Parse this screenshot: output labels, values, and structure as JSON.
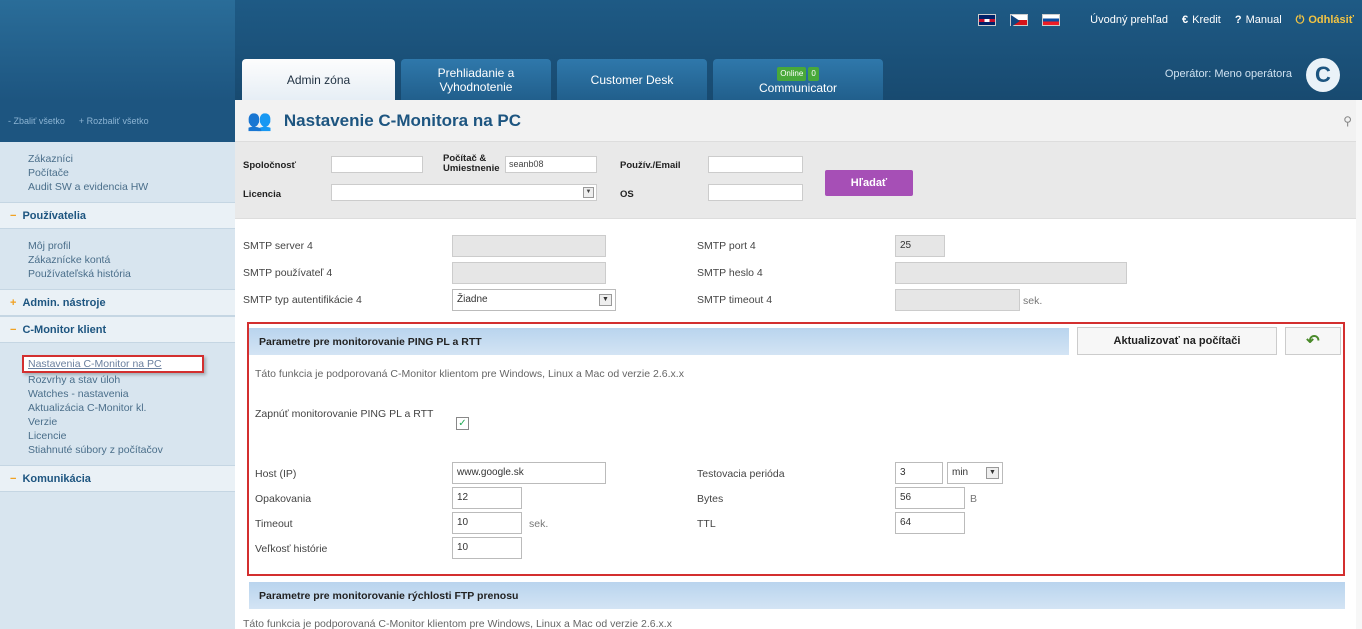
{
  "header": {
    "links": {
      "overview": "Úvodný prehľad",
      "credit": "Kredit",
      "manual": "Manual",
      "logout": "Odhlásiť"
    },
    "tabs": [
      {
        "label": "Admin zóna"
      },
      {
        "label": "Prehliadanie a Vyhodnotenie"
      },
      {
        "label": "Customer Desk"
      },
      {
        "label": "Communicator",
        "badge": "Online",
        "count": "0"
      }
    ],
    "operator": "Operátor: Meno operátora",
    "logo_letter": "C"
  },
  "sidebar": {
    "collapse_all": "Zbaliť všetko",
    "expand_all": "Rozbaliť všetko",
    "group1": [
      "Zákazníci",
      "Počítače",
      "Audit SW a evidencia HW"
    ],
    "users_header": "Používatelia",
    "users_items": [
      "Môj profil",
      "Zákaznícke kontá",
      "Používateľská história"
    ],
    "admin_header": "Admin. nástroje",
    "cmon_header": "C-Monitor klient",
    "cmon_items": [
      "Nastavenia C-Monitor na PC",
      "Rozvrhy a stav úloh",
      "Watches - nastavenia",
      "Aktualizácia C-Monitor kl.",
      "Verzie",
      "Licencie",
      "Stiahnuté súbory z počítačov"
    ],
    "comm_header": "Komunikácia"
  },
  "main": {
    "title": "Nastavenie C-Monitora na PC",
    "filter": {
      "company_label": "Spoločnosť",
      "computer_label": "Počítač & Umiestnenie",
      "computer_value": "seanb08",
      "user_label": "Použív./Email",
      "license_label": "Licencia",
      "os_label": "OS",
      "search_button": "Hľadať"
    },
    "smtp": {
      "server_label": "SMTP server 4",
      "port_label": "SMTP port 4",
      "port_value": "25",
      "user_label": "SMTP používateľ 4",
      "password_label": "SMTP heslo 4",
      "auth_label": "SMTP typ autentifikácie 4",
      "auth_value": "Žiadne",
      "timeout_label": "SMTP timeout 4",
      "timeout_unit": "sek."
    },
    "ping": {
      "header": "Parametre pre monitorovanie PING PL a RTT",
      "update_button": "Aktualizovať na počítači",
      "description": "Táto funkcia je podporovaná C-Monitor klientom pre Windows, Linux a Mac od verzie 2.6.x.x",
      "enable_label": "Zapnúť monitorovanie PING PL a RTT",
      "enable_checked": true,
      "host_label": "Host (IP)",
      "host_value": "www.google.sk",
      "period_label": "Testovacia perióda",
      "period_value": "3",
      "period_unit": "min",
      "repeat_label": "Opakovania",
      "repeat_value": "12",
      "bytes_label": "Bytes",
      "bytes_value": "56",
      "bytes_unit": "B",
      "timeout_label": "Timeout",
      "timeout_value": "10",
      "timeout_unit": "sek.",
      "ttl_label": "TTL",
      "ttl_value": "64",
      "history_label": "Veľkosť histórie",
      "history_value": "10"
    },
    "ftp": {
      "header": "Parametre pre monitorovanie rýchlosti FTP prenosu",
      "description": "Táto funkcia je podporovaná C-Monitor klientom pre Windows, Linux a Mac od verzie 2.6.x.x"
    }
  }
}
